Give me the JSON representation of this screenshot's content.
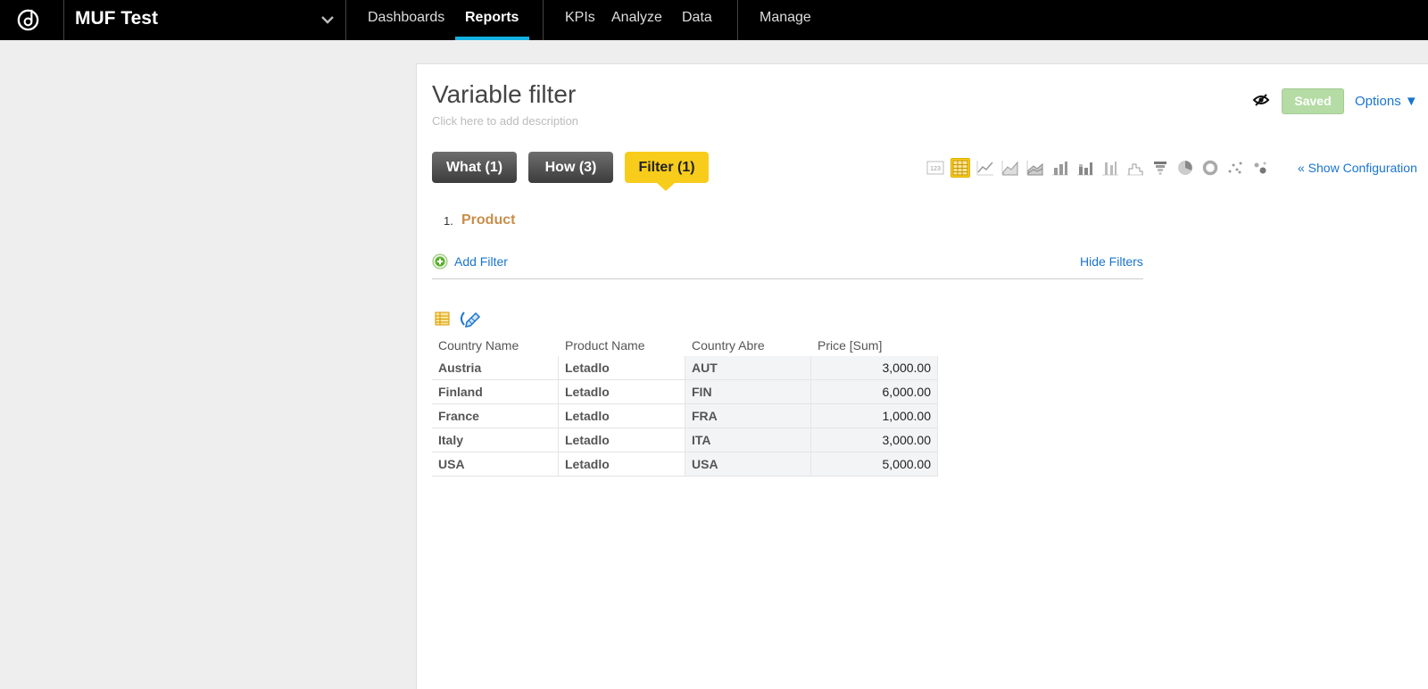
{
  "topbar": {
    "project": "MUF Test",
    "nav": [
      {
        "label": "Dashboards",
        "active": false
      },
      {
        "label": "Reports",
        "active": true
      },
      {
        "label": "KPIs",
        "active": false
      },
      {
        "label": "Analyze",
        "active": false
      },
      {
        "label": "Data",
        "active": false
      },
      {
        "label": "Manage",
        "active": false
      }
    ],
    "accent_color": "#14b2e2"
  },
  "report": {
    "title": "Variable filter",
    "description_placeholder": "Click here to add description",
    "saved_label": "Saved",
    "options_label": "Options ▼",
    "show_configuration": "« Show Configuration"
  },
  "tabs": [
    {
      "label": "What (1)",
      "state": "normal"
    },
    {
      "label": "How (3)",
      "state": "normal"
    },
    {
      "label": "Filter (1)",
      "state": "active"
    }
  ],
  "chart_types": [
    {
      "icon": "headline-number-icon",
      "selected": false
    },
    {
      "icon": "table-icon",
      "selected": true
    },
    {
      "icon": "line-chart-icon",
      "selected": false
    },
    {
      "icon": "area-chart-icon",
      "selected": false
    },
    {
      "icon": "stacked-area-chart-icon",
      "selected": false
    },
    {
      "icon": "bar-chart-icon",
      "selected": false
    },
    {
      "icon": "stacked-bar-chart-icon",
      "selected": false
    },
    {
      "icon": "bullet-chart-icon",
      "selected": false
    },
    {
      "icon": "waterfall-chart-icon",
      "selected": false
    },
    {
      "icon": "funnel-chart-icon",
      "selected": false
    },
    {
      "icon": "pie-chart-icon",
      "selected": false
    },
    {
      "icon": "donut-chart-icon",
      "selected": false
    },
    {
      "icon": "scatter-chart-icon",
      "selected": false
    },
    {
      "icon": "bubble-chart-icon",
      "selected": false
    }
  ],
  "filters": {
    "items": [
      {
        "number": "1.",
        "label": "Product"
      }
    ],
    "add_label": "Add Filter",
    "hide_label": "Hide Filters"
  },
  "table": {
    "columns": [
      "Country Name",
      "Product Name",
      "Country Abre",
      "Price [Sum]"
    ],
    "rows": [
      [
        "Austria",
        "Letadlo",
        "AUT",
        "3,000.00"
      ],
      [
        "Finland",
        "Letadlo",
        "FIN",
        "6,000.00"
      ],
      [
        "France",
        "Letadlo",
        "FRA",
        "1,000.00"
      ],
      [
        "Italy",
        "Letadlo",
        "ITA",
        "3,000.00"
      ],
      [
        "USA",
        "Letadlo",
        "USA",
        "5,000.00"
      ]
    ]
  }
}
